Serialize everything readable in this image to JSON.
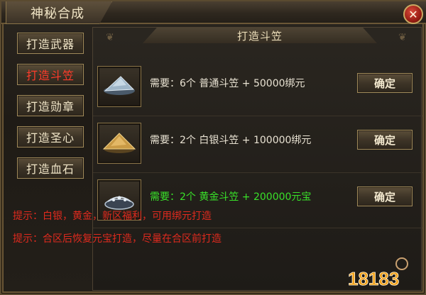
{
  "window": {
    "title": "神秘合成"
  },
  "close_icon": "close-icon",
  "sidebar": {
    "items": [
      {
        "label": "打造武器",
        "active": false
      },
      {
        "label": "打造斗笠",
        "active": true
      },
      {
        "label": "打造勋章",
        "active": false
      },
      {
        "label": "打造圣心",
        "active": false
      },
      {
        "label": "打造血石",
        "active": false
      }
    ]
  },
  "content": {
    "header": "打造斗笠",
    "recipes": [
      {
        "requirement": "需要：6个 普通斗笠 + 50000绑元",
        "confirm_label": "确定",
        "item_icon": "silver-hat-icon",
        "highlight": false
      },
      {
        "requirement": "需要：2个 白银斗笠 + 100000绑元",
        "confirm_label": "确定",
        "item_icon": "gold-hat-icon",
        "highlight": false
      },
      {
        "requirement": "需要：2个 黄金斗笠 + 200000元宝",
        "confirm_label": "确定",
        "item_icon": "crown-hat-icon",
        "highlight": true
      }
    ],
    "tips": [
      "提示：白银，黄金，新区福利，可用绑元打造",
      "提示：合区后恢复元宝打造，尽量在合区前打造"
    ]
  },
  "watermark": {
    "text": "18183"
  },
  "colors": {
    "active_tab": "#ff3b2a",
    "tip": "#e02a1e",
    "highlight": "#39e029",
    "gold_border": "#a08a5a"
  }
}
